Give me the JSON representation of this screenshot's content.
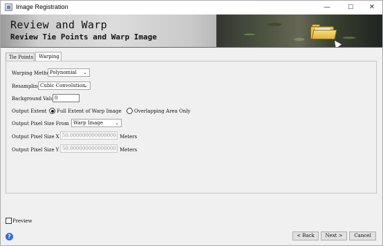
{
  "window": {
    "title": "Image Registration",
    "minimize_glyph": "—",
    "maximize_glyph": "☐",
    "close_glyph": "✕"
  },
  "banner": {
    "title": "Review and Warp",
    "subtitle": "Review Tie Points and Warp Image"
  },
  "tabs": [
    {
      "label": "Tie Points",
      "selected": false
    },
    {
      "label": "Warping",
      "selected": true
    }
  ],
  "form": {
    "warping_method": {
      "label": "Warping Method",
      "value": "Polynomial"
    },
    "resampling": {
      "label": "Resampling",
      "value": "Cubic Convolution"
    },
    "background_value": {
      "label": "Background Value",
      "value": "0"
    },
    "output_extent": {
      "label": "Output Extent",
      "options": [
        {
          "label": "Full Extent of Warp Image",
          "checked": true
        },
        {
          "label": "Overlapping Area Only",
          "checked": false
        }
      ]
    },
    "output_pixel_size_from": {
      "label": "Output Pixel Size From",
      "value": "Warp Image"
    },
    "pixel_size_x": {
      "label": "Output Pixel Size X",
      "value": "50.000000000000000",
      "unit": "Meters"
    },
    "pixel_size_y": {
      "label": "Output Pixel Size Y",
      "value": "50.000000000000000",
      "unit": "Meters"
    }
  },
  "footer": {
    "preview_label": "Preview",
    "preview_checked": false,
    "help_glyph": "?",
    "back_label": "< Back",
    "next_label": "Next >",
    "cancel_label": "Cancel"
  },
  "icons": {
    "app": "image-registration-icon",
    "help": "help-icon",
    "dropdown": "chevron-down-icon",
    "banner": "folder-icon"
  },
  "colors": {
    "window_bg": "#f0f0f0",
    "help_blue": "#2f6fd0",
    "disabled_text": "#9a9a9a"
  }
}
